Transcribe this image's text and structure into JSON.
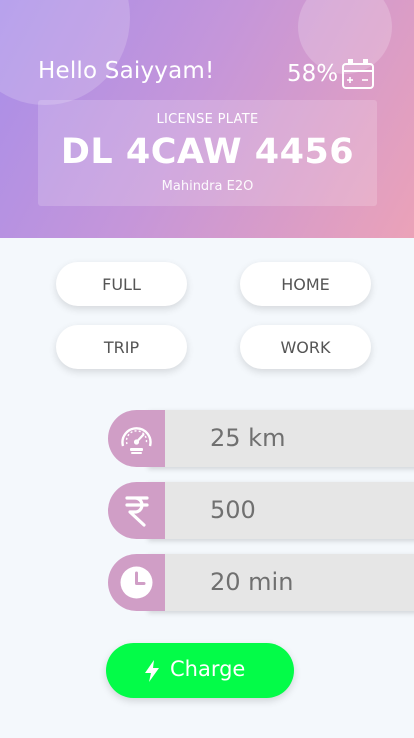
{
  "header": {
    "greeting": "Hello Saiyyam!",
    "battery_percent": "58%",
    "battery_icon": "battery-icon"
  },
  "vehicle": {
    "plate_label": "LICENSE PLATE",
    "plate_number": "DL 4CAW 4456",
    "model": "Mahindra E2O"
  },
  "modes": {
    "full": "FULL",
    "home": "HOME",
    "trip": "TRIP",
    "work": "WORK"
  },
  "stats": {
    "distance": {
      "icon": "speedometer-icon",
      "value": "25 km"
    },
    "cost": {
      "icon": "rupee-icon",
      "value": "500"
    },
    "time": {
      "icon": "clock-icon",
      "value": "20 min"
    }
  },
  "action": {
    "charge_label": "Charge",
    "charge_icon": "bolt-icon"
  },
  "colors": {
    "header_gradient_start": "#a88ee9",
    "header_gradient_end": "#eba2b8",
    "icon_accent": "#d09ec6",
    "charge_button": "#03fc48"
  }
}
